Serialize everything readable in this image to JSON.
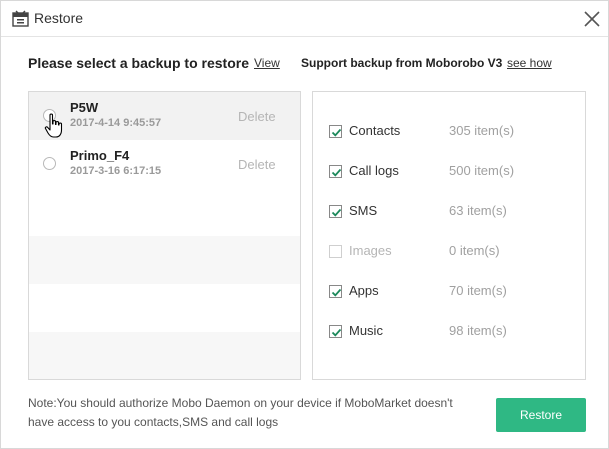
{
  "window": {
    "title": "Restore"
  },
  "left": {
    "heading": "Please select a backup to restore",
    "view_link": "View",
    "backups": [
      {
        "name": "P5W",
        "date": "2017-4-14 9:45:57",
        "delete": "Delete"
      },
      {
        "name": "Primo_F4",
        "date": "2017-3-16 6:17:15",
        "delete": "Delete"
      }
    ]
  },
  "right": {
    "heading": "Support backup from Moborobo V3",
    "see_how_link": "see how",
    "categories": [
      {
        "label": "Contacts",
        "count": "305 item(s)",
        "checked": true
      },
      {
        "label": "Call logs",
        "count": "500 item(s)",
        "checked": true
      },
      {
        "label": "SMS",
        "count": "63 item(s)",
        "checked": true
      },
      {
        "label": "Images",
        "count": "0 item(s)",
        "checked": false
      },
      {
        "label": "Apps",
        "count": "70 item(s)",
        "checked": true
      },
      {
        "label": "Music",
        "count": "98 item(s)",
        "checked": true
      }
    ]
  },
  "footer": {
    "note": "Note:You should authorize Mobo Daemon on your device if MoboMarket doesn't have access to you contacts,SMS and call logs",
    "restore_button": "Restore"
  },
  "colors": {
    "accent": "#2fb884",
    "check": "#1c8a5c"
  }
}
